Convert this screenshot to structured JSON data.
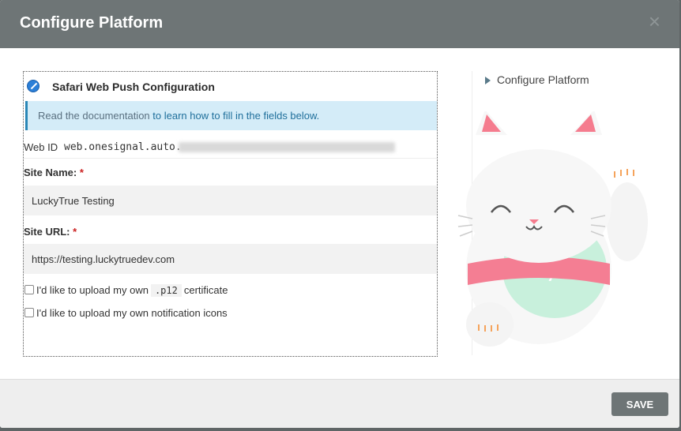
{
  "header": {
    "title": "Configure Platform",
    "close_label": "×"
  },
  "form": {
    "section_title": "Safari Web Push Configuration",
    "info": {
      "prefix": "Read the documentation ",
      "link": "to learn how to fill in the fields below."
    },
    "web_id": {
      "label": "Web ID",
      "value": "web.onesignal.auto."
    },
    "site_name": {
      "label": "Site Name:",
      "required": "*",
      "value": "LuckyTrue Testing"
    },
    "site_url": {
      "label": "Site URL:",
      "required": "*",
      "value": "https://testing.luckytruedev.com"
    },
    "check_p12": {
      "before": "I'd like to upload my own",
      "code": ".p12",
      "after": "certificate"
    },
    "check_icons": {
      "label": "I'd like to upload my own notification icons"
    }
  },
  "side_nav": {
    "item": "Configure Platform"
  },
  "mascot": {
    "badge": "</>"
  },
  "footer": {
    "save_label": "SAVE"
  }
}
